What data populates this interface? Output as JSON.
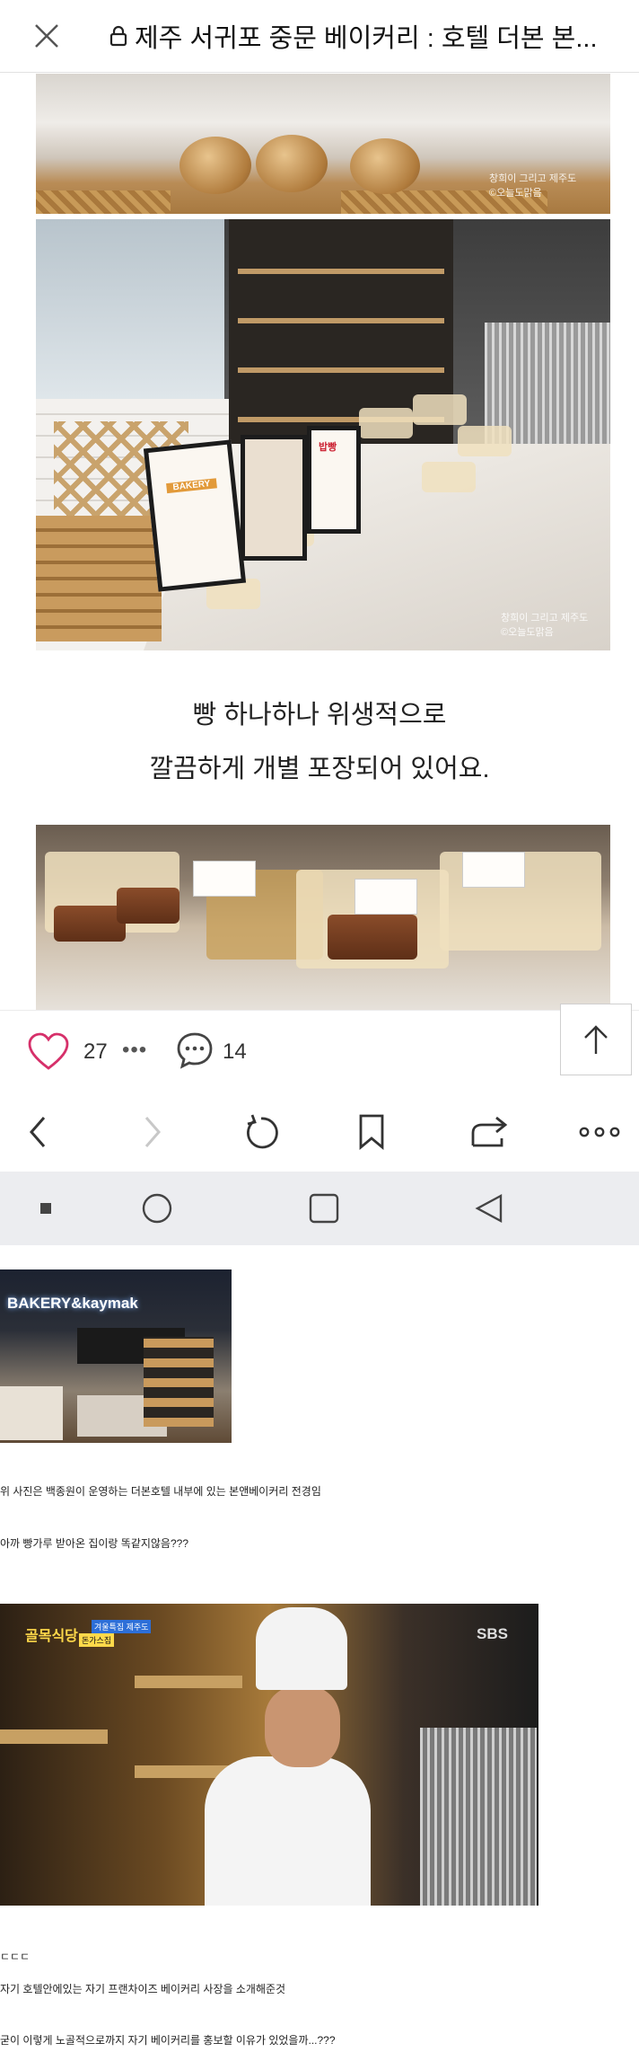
{
  "header": {
    "title": "제주 서귀포 중문 베이커리 : 호텔 더본 본...",
    "close_icon": "close-icon",
    "lock_icon": "lock-icon"
  },
  "photos": {
    "top_watermark": "창희이 그리고 제주도\n©오늘도맑음",
    "shop_watermark": "창희이 그리고 제주도\n©오늘도맑음",
    "sign_main": "BAKERY",
    "sign_right": "밥빵"
  },
  "caption": {
    "line1": "빵 하나하나 위생적으로",
    "line2": "깔끔하게 개별 포장되어 있어요."
  },
  "actions": {
    "like_count": "27",
    "more": "•••",
    "comment_count": "14",
    "like_icon": "heart-icon",
    "comment_icon": "comment-icon",
    "top_icon": "arrow-up-icon"
  },
  "browser_nav": {
    "back_icon": "chevron-left-icon",
    "forward_icon": "chevron-right-icon",
    "reload_icon": "reload-icon",
    "bookmark_icon": "bookmark-icon",
    "share_icon": "share-icon",
    "menu_icon": "more-horizontal-icon"
  },
  "system_nav": {
    "recents_icon": "recents-icon",
    "home_icon": "home-icon",
    "square_icon": "square-icon",
    "back_icon": "triangle-back-icon"
  },
  "post": {
    "bakery_sign": "BAKERY&kaymak",
    "chef_channel": "SBS",
    "show_logo": "골목식당",
    "show_tag1": "겨울특집 제주도",
    "show_tag2": "돈가스집",
    "line1": "위 사진은 백종원이 운영하는 더본호텔 내부에 있는 본앤베이커리 전경임",
    "line2": "아까 빵가루 받아온 집이랑 똑같지않음???",
    "line3": "ㄷㄷㄷ",
    "line4": "자기 호텔안에있는 자기 프랜차이즈 베이커리 사장을 소개해준것",
    "line5": "굳이 이렇게 노골적으로까지 자기 베이커리를 홍보할 이유가 있었을까...???"
  },
  "colors": {
    "accent_heart": "#d6306a",
    "icon_gray": "#444444",
    "system_nav_bg": "#ecedf0"
  }
}
